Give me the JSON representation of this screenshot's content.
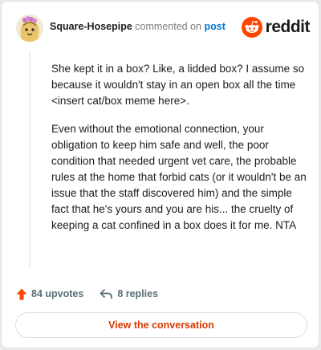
{
  "header": {
    "username": "Square-Hosepipe",
    "action_text": "commented on",
    "post_link": "post",
    "brand": "reddit"
  },
  "comment": {
    "paragraphs": [
      "She kept it in a box? Like, a lidded box? I assume so because it wouldn't stay in an open box all the time <insert cat/box meme here>.",
      "Even without the emotional connection, your obligation to keep him safe and well, the poor condition that needed urgent vet care, the probable rules at the home that forbid cats (or it wouldn't be an issue that the staff discovered him) and the simple fact that he's yours and you are his... the cruelty of keeping a cat confined in a box does it for me. NTA"
    ]
  },
  "stats": {
    "upvotes": "84 upvotes",
    "replies": "8 replies"
  },
  "cta": {
    "label": "View the conversation"
  },
  "colors": {
    "brand_orange": "#ff4500",
    "link_blue": "#0079d3",
    "cta_text": "#d93a00"
  },
  "icons": {
    "upvote": "upvote-arrow-icon",
    "reply": "reply-arrow-icon",
    "logo": "reddit-snoo-icon"
  }
}
